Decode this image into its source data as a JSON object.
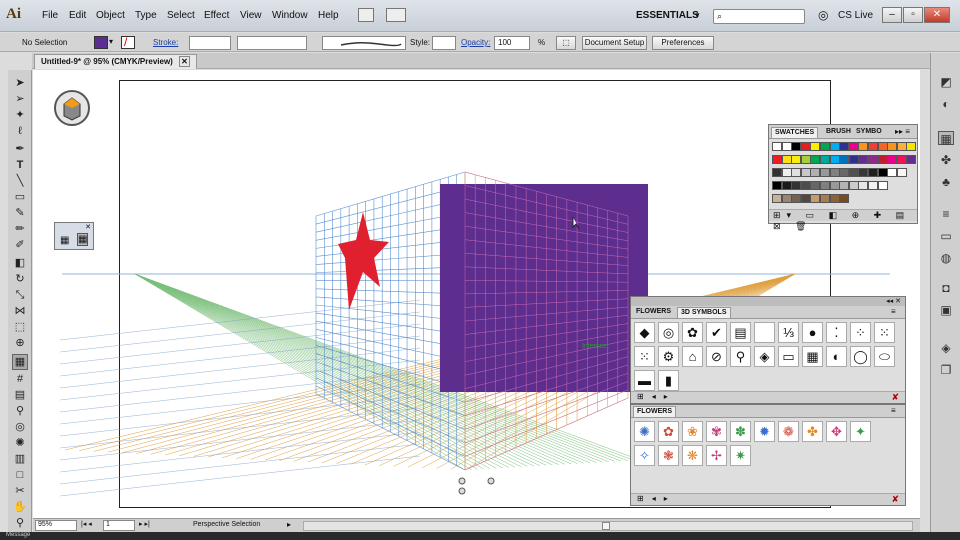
{
  "app": {
    "logo": "Ai",
    "workspace": "ESSENTIALS",
    "cs_live": "CS Live"
  },
  "menu": [
    "File",
    "Edit",
    "Object",
    "Type",
    "Select",
    "Effect",
    "View",
    "Window",
    "Help"
  ],
  "control": {
    "selection": "No Selection",
    "stroke_label": "Stroke:",
    "style_label": "Style:",
    "opacity_label": "Opacity:",
    "opacity_value": "100",
    "opacity_unit": "%",
    "doc_setup": "Document Setup",
    "preferences": "Preferences",
    "fill_color": "#5a2d91"
  },
  "document": {
    "tab_title": "Untitled-9* @ 95% (CMYK/Preview)"
  },
  "canvas": {
    "intersect_label": "Intersect",
    "star_color": "#e0202e",
    "square_color": "#5b2a8c"
  },
  "status": {
    "zoom": "95%",
    "artboard": "1",
    "tool": "Perspective Selection",
    "bottom_text": "Message"
  },
  "swatches": {
    "tabs": [
      "SWATCHES",
      "BRUSH",
      "SYMBO"
    ],
    "row1": [
      "#ffffff",
      "#ffffff",
      "#000000",
      "#e31e24",
      "#ffed00",
      "#00a650",
      "#00aeef",
      "#2e3192",
      "#ec008c",
      "#f7941d",
      "#ee4036",
      "#f26522",
      "#f7941d",
      "#fbaf3f",
      "#f5e600"
    ],
    "row2": [
      "#ed1c24",
      "#ffde17",
      "#f7ec13",
      "#a6ce39",
      "#00a651",
      "#00a99d",
      "#00aeef",
      "#0072bc",
      "#2e3192",
      "#662d91",
      "#92278f",
      "#be1e2d",
      "#ec008c",
      "#ed145b",
      "#662d91"
    ],
    "row3": [
      "#333333",
      "#f0f0f0",
      "#e0e0e0",
      "#c8c8c8",
      "#b0b0b0",
      "#989898",
      "#808080",
      "#686868",
      "#505050",
      "#383838",
      "#202020",
      "#000000",
      "#ffffff",
      "#f7f7f7"
    ],
    "row4": [
      "#000000",
      "#1a1a1a",
      "#333333",
      "#4d4d4d",
      "#666666",
      "#808080",
      "#999999",
      "#b3b3b3",
      "#cccccc",
      "#e6e6e6",
      "#f2f2f2",
      "#ffffff"
    ],
    "row5": [
      "#c7b299",
      "#998675",
      "#736357",
      "#534741",
      "#c69c6d",
      "#a67c52",
      "#8c6239",
      "#754c24"
    ]
  },
  "symbols_panel": {
    "tabs": [
      "FLOWERS",
      "3D SYMBOLS"
    ],
    "items": [
      "◆",
      "◎",
      "✿",
      "✔",
      "▤",
      "",
      "⅓",
      "●",
      "⁚",
      "⁘",
      "⁙",
      "⁙",
      "⚙",
      "⌂",
      "⊘",
      "⚲",
      "◈",
      "▭",
      "▦",
      "◐",
      "◯",
      "⬭",
      "▬",
      "▮"
    ]
  },
  "flowers_panel": {
    "tabs": [
      "FLOWERS"
    ],
    "items": [
      "✺",
      "✿",
      "❀",
      "✾",
      "✽",
      "✹",
      "❁",
      "✤",
      "✥",
      "✦",
      "✧",
      "❃",
      "❋",
      "✢",
      "✷"
    ]
  }
}
